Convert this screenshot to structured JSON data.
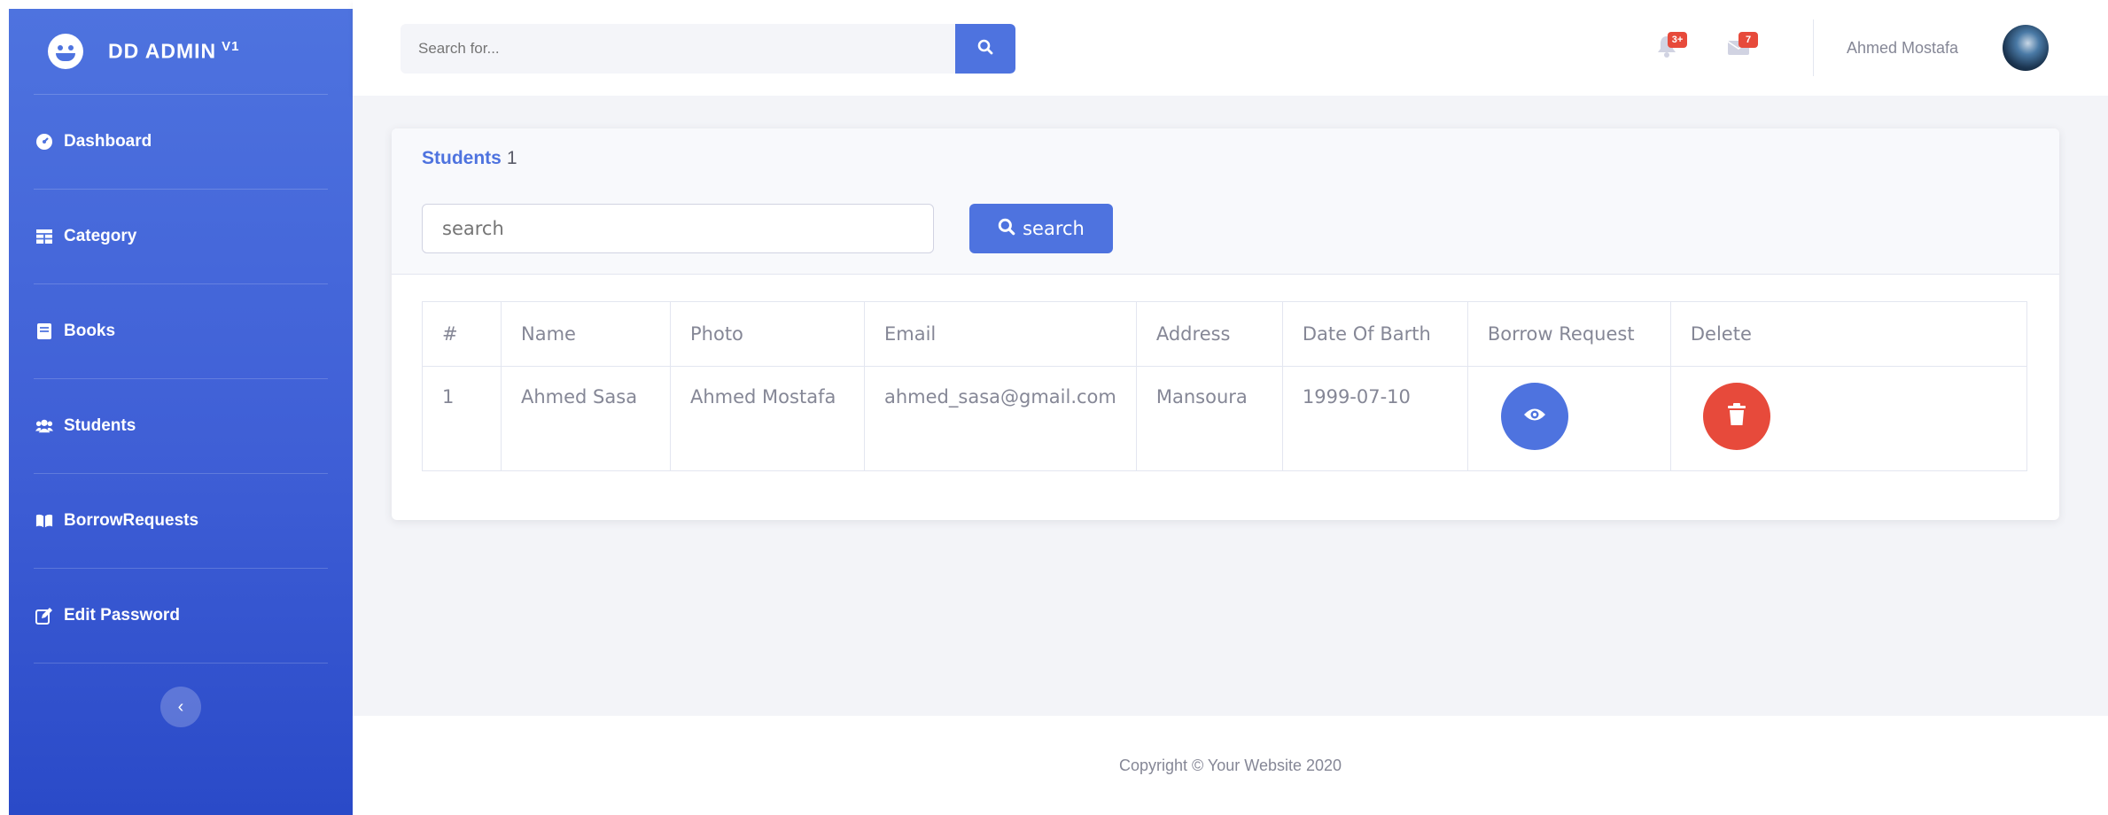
{
  "app": {
    "brand": "DD ADMIN",
    "version": "V1"
  },
  "colors": {
    "primary": "#4e73df",
    "danger": "#e74a3b",
    "text_muted": "#858796"
  },
  "sidebar": {
    "items": [
      {
        "label": "Dashboard",
        "icon": "tachometer-icon"
      },
      {
        "label": "Category",
        "icon": "table-icon"
      },
      {
        "label": "Books",
        "icon": "book-icon"
      },
      {
        "label": "Students",
        "icon": "users-icon"
      },
      {
        "label": "BorrowRequests",
        "icon": "book-open-icon"
      },
      {
        "label": "Edit Password",
        "icon": "edit-icon"
      }
    ],
    "toggle_glyph": "‹"
  },
  "topbar": {
    "search_placeholder": "Search for...",
    "alerts_badge": "3+",
    "messages_badge": "7",
    "user_name": "Ahmed Mostafa"
  },
  "card": {
    "title": "Students",
    "count": "1",
    "filter_placeholder": "search",
    "filter_button": "search"
  },
  "table": {
    "headers": [
      "#",
      "Name",
      "Photo",
      "Email",
      "Address",
      "Date Of Barth",
      "Borrow Request",
      "Delete"
    ],
    "rows": [
      {
        "num": "1",
        "name": "Ahmed Sasa",
        "photo": "Ahmed Mostafa",
        "email": "ahmed_sasa@gmail.com",
        "address": "Mansoura",
        "dob": "1999-07-10"
      }
    ]
  },
  "footer": {
    "copyright": "Copyright © Your Website 2020"
  }
}
